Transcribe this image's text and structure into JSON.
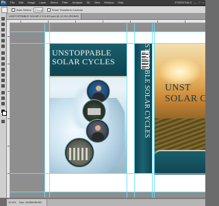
{
  "menubar": {
    "logo": "Ps",
    "items": [
      "File",
      "Edit",
      "Image",
      "Layer",
      "Select",
      "Filter",
      "Analysis",
      "3D",
      "View",
      "Window",
      "Help"
    ],
    "right": [
      "ESSENTIALS",
      "—",
      "□",
      "×"
    ]
  },
  "options": {
    "auto_select_label": "Auto-Select:",
    "auto_select_value": "Group",
    "transform_label": "Show Transform Controls"
  },
  "document": {
    "tab_title": "UNSTOPPABLE SOLAR CYCLES.psd @ 12.5% (RGB/8)"
  },
  "artwork": {
    "back_title_1": "UNSTOPPABLE",
    "back_title_2": "SOLAR CYCLES",
    "spine_title": "UNSTOPPABLE SOLAR CYCLES",
    "front_title_1": "UNST",
    "front_title_2": "SOLAR C"
  },
  "status": {
    "zoom": "12.5%",
    "doc": "Doc: 48.8M/48.8M"
  }
}
